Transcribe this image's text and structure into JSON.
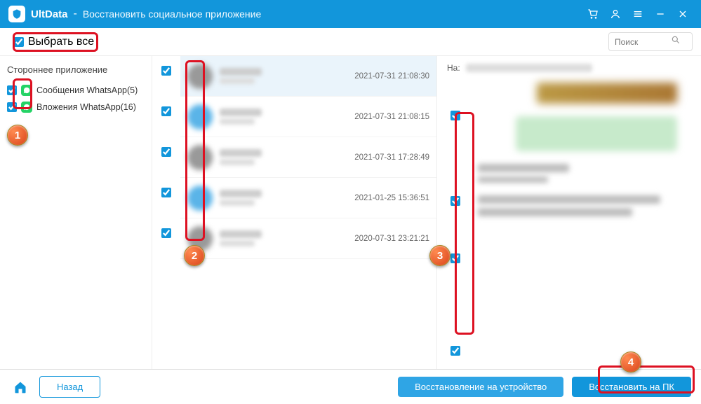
{
  "title": {
    "app": "UltData",
    "sep": "-",
    "sub": "Восстановить социальное приложение"
  },
  "toolbar": {
    "select_all": "Выбрать все",
    "search_placeholder": "Поиск"
  },
  "sidebar": {
    "heading": "Стороннее приложение",
    "items": [
      {
        "label": "Сообщения WhatsApp(5)"
      },
      {
        "label": "Вложения WhatsApp(16)"
      }
    ]
  },
  "conversations": [
    {
      "time": "2021-07-31 21:08:30",
      "selected": true,
      "avatar": "a"
    },
    {
      "time": "2021-07-31 21:08:15",
      "avatar": "b"
    },
    {
      "time": "2021-07-31 17:28:49",
      "avatar": "a"
    },
    {
      "time": "2021-01-25 15:36:51",
      "avatar": "b"
    },
    {
      "time": "2020-07-31 23:21:21",
      "avatar": "a"
    }
  ],
  "detail": {
    "to_label": "На:"
  },
  "footer": {
    "back": "Назад",
    "restore_device": "Восстановление на устройство",
    "restore_pc": "Восстановить на ПК"
  },
  "annotations": {
    "b1": "1",
    "b2": "2",
    "b3": "3",
    "b4": "4"
  }
}
